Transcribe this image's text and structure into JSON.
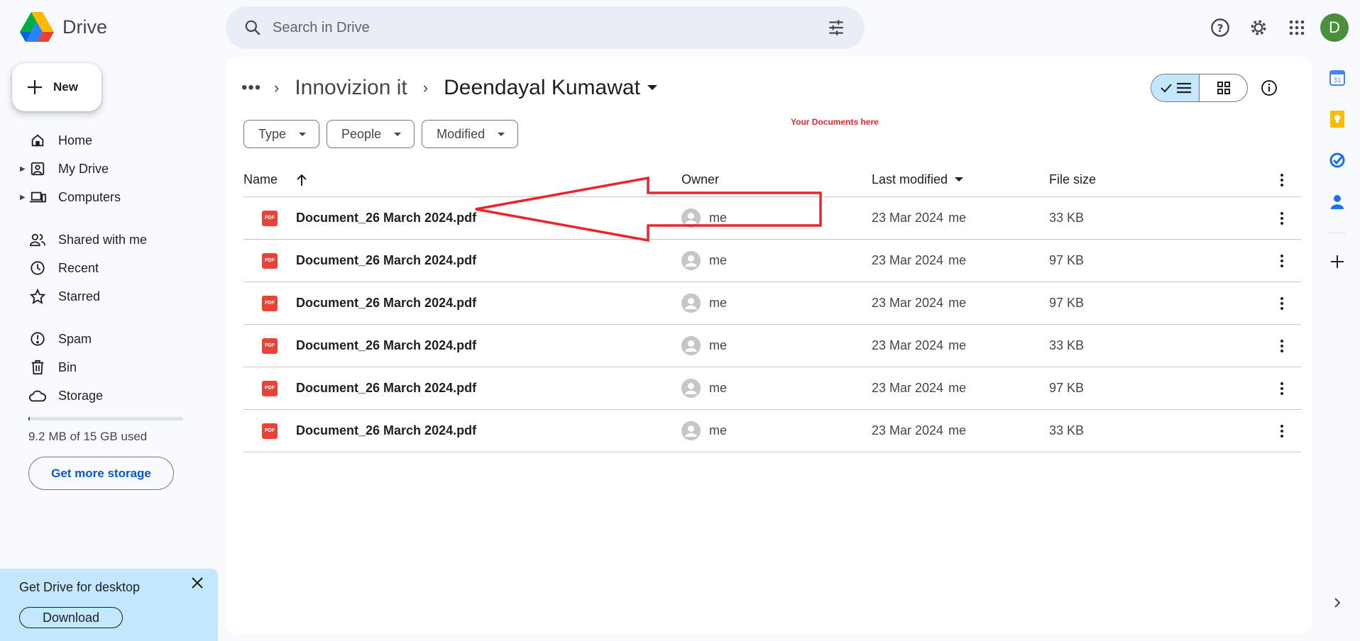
{
  "app": {
    "name": "Drive"
  },
  "search": {
    "placeholder": "Search in Drive"
  },
  "user": {
    "initial": "D"
  },
  "sidebar": {
    "new_label": "New",
    "items": [
      {
        "label": "Home",
        "icon": "home-icon"
      },
      {
        "label": "My Drive",
        "icon": "my-drive-icon"
      },
      {
        "label": "Computers",
        "icon": "computers-icon"
      },
      {
        "label": "Shared with me",
        "icon": "shared-icon"
      },
      {
        "label": "Recent",
        "icon": "clock-icon"
      },
      {
        "label": "Starred",
        "icon": "star-icon"
      },
      {
        "label": "Spam",
        "icon": "spam-icon"
      },
      {
        "label": "Bin",
        "icon": "bin-icon"
      },
      {
        "label": "Storage",
        "icon": "cloud-icon"
      }
    ],
    "storage_used_fraction": 0.0006,
    "storage_text": "9.2 MB of 15 GB used",
    "get_storage_label": "Get more storage"
  },
  "desktop_promo": {
    "title": "Get Drive for desktop",
    "download_label": "Download"
  },
  "breadcrumb": {
    "parent": "Innovizion it",
    "current": "Deendayal Kumawat"
  },
  "filters": [
    "Type",
    "People",
    "Modified"
  ],
  "annotation": {
    "text": "Your Documents here",
    "color": "#e8262e"
  },
  "table": {
    "headers": {
      "name": "Name",
      "owner": "Owner",
      "modified": "Last modified",
      "size": "File size"
    },
    "rows": [
      {
        "name": "Document_26 March 2024.pdf",
        "owner": "me",
        "modified_date": "23 Mar 2024",
        "modified_by": "me",
        "size": "33 KB"
      },
      {
        "name": "Document_26 March 2024.pdf",
        "owner": "me",
        "modified_date": "23 Mar 2024",
        "modified_by": "me",
        "size": "97 KB"
      },
      {
        "name": "Document_26 March 2024.pdf",
        "owner": "me",
        "modified_date": "23 Mar 2024",
        "modified_by": "me",
        "size": "97 KB"
      },
      {
        "name": "Document_26 March 2024.pdf",
        "owner": "me",
        "modified_date": "23 Mar 2024",
        "modified_by": "me",
        "size": "33 KB"
      },
      {
        "name": "Document_26 March 2024.pdf",
        "owner": "me",
        "modified_date": "23 Mar 2024",
        "modified_by": "me",
        "size": "97 KB"
      },
      {
        "name": "Document_26 March 2024.pdf",
        "owner": "me",
        "modified_date": "23 Mar 2024",
        "modified_by": "me",
        "size": "33 KB"
      }
    ]
  },
  "pdf_badge": "PDF",
  "colors": {
    "accent": "#0b57d0",
    "selected": "#c2e7ff",
    "pdf": "#ea4335"
  }
}
